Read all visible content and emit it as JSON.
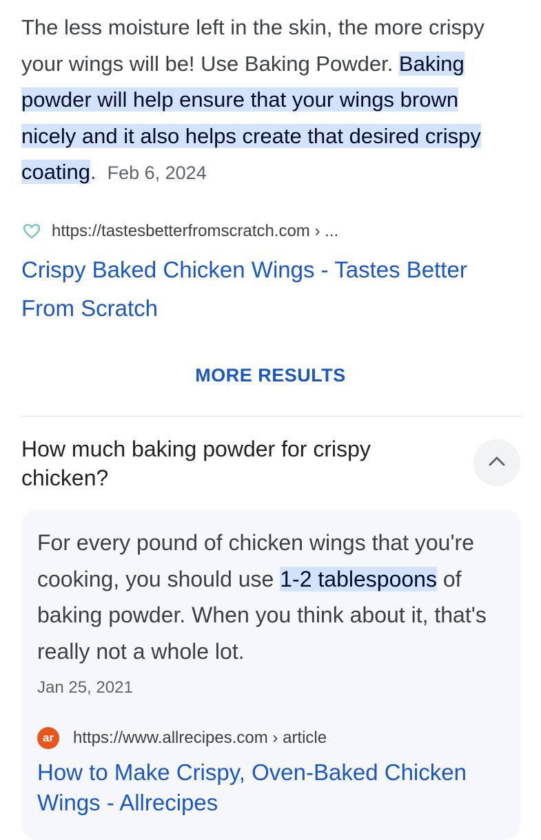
{
  "snippet1": {
    "text_before": "The less moisture left in the skin, the more crispy your wings will be! Use Baking Powder. ",
    "highlight": "Baking powder will help ensure that your wings brown nicely and it also helps create that desired crispy coating",
    "text_after": ".",
    "date": "Feb 6, 2024"
  },
  "source1": {
    "icon": "heart-icon",
    "url": "https://tastesbetterfromscratch.com › ...",
    "title": "Crispy Baked Chicken Wings - Tastes Better From Scratch"
  },
  "more_results_label": "MORE RESULTS",
  "faq": {
    "question": "How much baking powder for crispy chicken?",
    "toggle_icon": "chevron-up-icon",
    "answer_before": "For every pound of chicken wings that you're cooking, you should use ",
    "answer_highlight": "1-2 tablespoons",
    "answer_after": " of baking powder. When you think about it, that's really not a whole lot.",
    "date": "Jan 25, 2021",
    "source": {
      "favicon_text": "ar",
      "url": "https://www.allrecipes.com › article",
      "title": "How to Make Crispy, Oven-Baked Chicken Wings - Allrecipes"
    }
  },
  "colors": {
    "link": "#1a57c6",
    "highlight": "#d3e3fd",
    "allrecipes_brand": "#e8561c",
    "heart_icon": "#7ec4c4"
  }
}
